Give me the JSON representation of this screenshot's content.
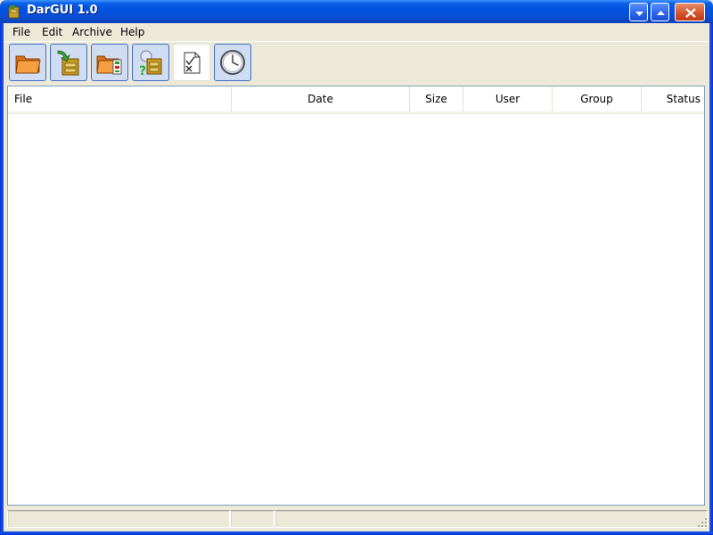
{
  "window": {
    "title": "DarGUI 1.0",
    "app_icon": "archive-box-icon",
    "controls": [
      "minimize-icon",
      "maximize-icon",
      "close-icon"
    ]
  },
  "menu": [
    "File",
    "Edit",
    "Archive",
    "Help"
  ],
  "toolbar": [
    {
      "name": "open-folder-button",
      "icon": "folder-icon"
    },
    {
      "name": "extract-archive-button",
      "icon": "archive-extract-icon"
    },
    {
      "name": "create-archive-button",
      "icon": "folder-archive-icon"
    },
    {
      "name": "test-archive-button",
      "icon": "archive-test-icon"
    },
    {
      "name": "compare-button",
      "icon": "document-check-icon"
    },
    {
      "name": "schedule-button",
      "icon": "clock-icon"
    }
  ],
  "list": {
    "columns": [
      "File",
      "Date",
      "Size",
      "User",
      "Group",
      "Status"
    ],
    "rows": []
  },
  "colors": {
    "titlebar": "#0a5fe8",
    "frame": "#0831d9",
    "face": "#ece9d8",
    "list_border": "#7f9db9"
  }
}
